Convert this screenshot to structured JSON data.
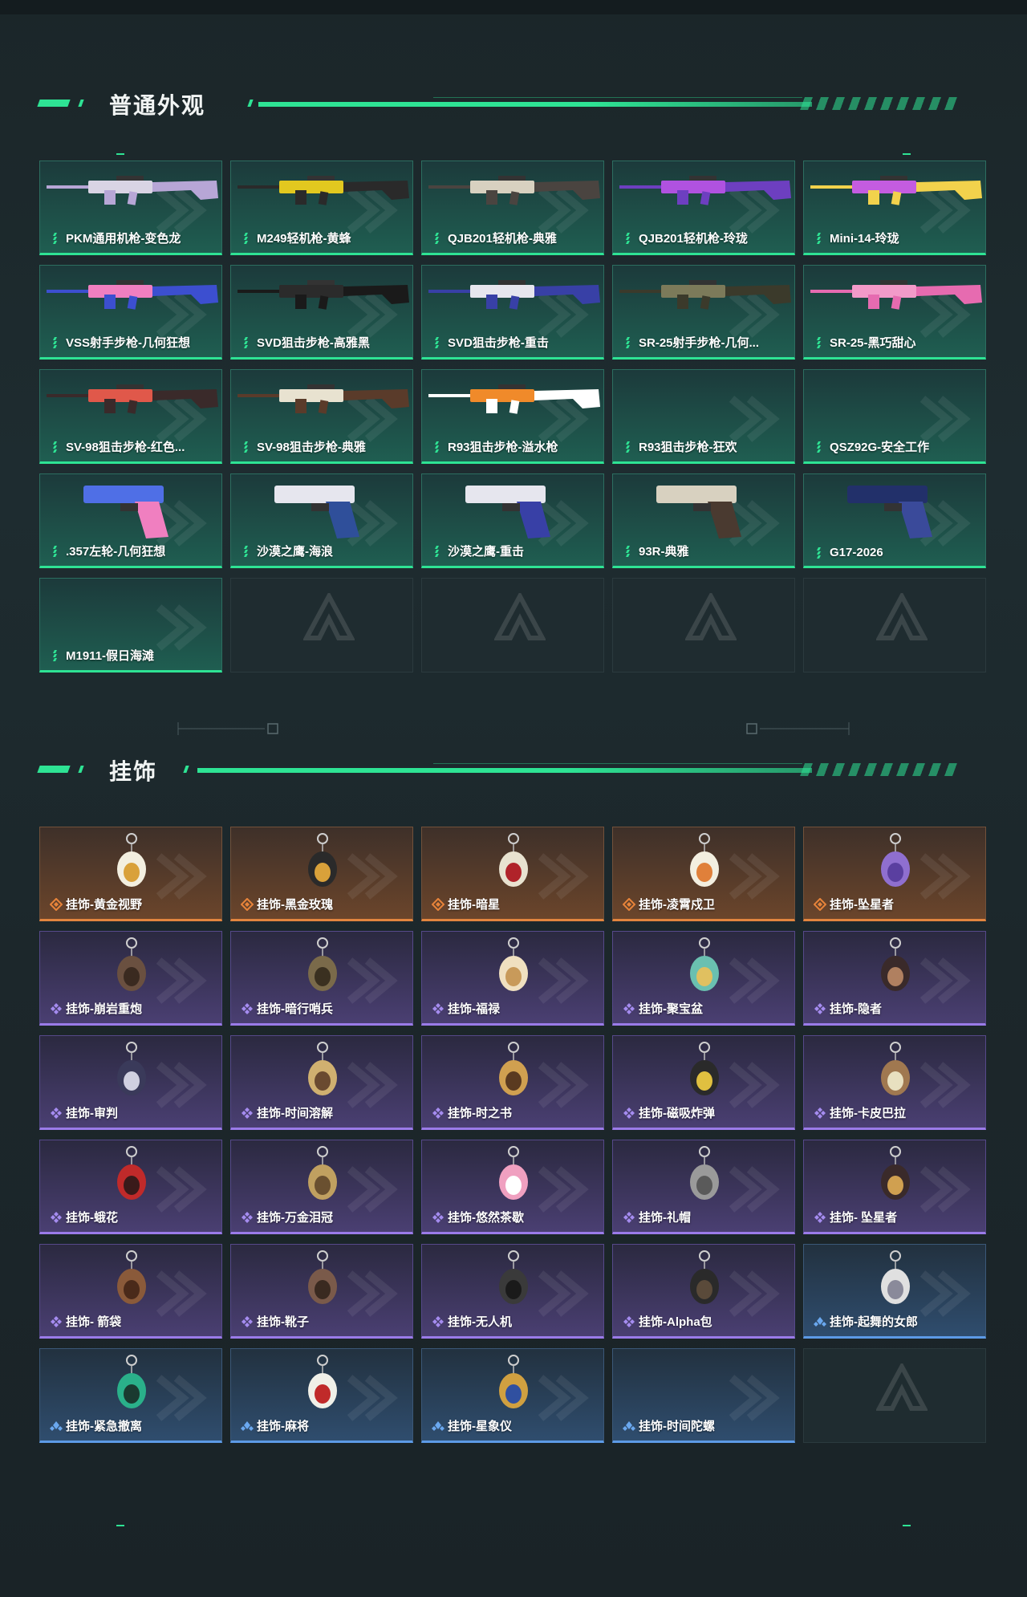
{
  "sections": [
    {
      "title": "普通外观",
      "items": [
        {
          "label": "PKM通用机枪-变色龙",
          "quality": "green",
          "art": "rifle",
          "colors": [
            "#d9d4e4",
            "#b7a6d6"
          ]
        },
        {
          "label": "M249轻机枪-黄蜂",
          "quality": "green",
          "art": "rifle",
          "colors": [
            "#e2c81f",
            "#2a2a2a"
          ]
        },
        {
          "label": "QJB201轻机枪-典雅",
          "quality": "green",
          "art": "rifle",
          "colors": [
            "#d8d1c0",
            "#4a4440"
          ]
        },
        {
          "label": "QJB201轻机枪-玲珑",
          "quality": "green",
          "art": "rifle",
          "colors": [
            "#b052e0",
            "#6d3fc0"
          ]
        },
        {
          "label": "Mini-14-玲珑",
          "quality": "green",
          "art": "rifle",
          "colors": [
            "#c45ce0",
            "#f2d24c"
          ]
        },
        {
          "label": "VSS射手步枪-几何狂想",
          "quality": "green",
          "art": "rifle",
          "colors": [
            "#f07fc0",
            "#3c4fd0"
          ]
        },
        {
          "label": "SVD狙击步枪-高雅黑",
          "quality": "green",
          "art": "rifle",
          "colors": [
            "#2b2b2b",
            "#1a1a1a"
          ]
        },
        {
          "label": "SVD狙击步枪-重击",
          "quality": "green",
          "art": "rifle",
          "colors": [
            "#e6e6ee",
            "#3840a6"
          ]
        },
        {
          "label": "SR-25射手步枪-几何...",
          "quality": "green",
          "art": "rifle",
          "colors": [
            "#7c7a5a",
            "#3b3a2b"
          ]
        },
        {
          "label": "SR-25-黑巧甜心",
          "quality": "green",
          "art": "rifle",
          "colors": [
            "#f29ac9",
            "#e66bb0"
          ]
        },
        {
          "label": "SV-98狙击步枪-红色...",
          "quality": "green",
          "art": "rifle",
          "colors": [
            "#e0584a",
            "#3a2a2a"
          ]
        },
        {
          "label": "SV-98狙击步枪-典雅",
          "quality": "green",
          "art": "rifle",
          "colors": [
            "#e8e2d0",
            "#5a3b2a"
          ]
        },
        {
          "label": "R93狙击步枪-溢水枪",
          "quality": "green",
          "art": "rifle",
          "colors": [
            "#f08a2a",
            "#ffffff"
          ]
        },
        {
          "label": "R93狙击步枪-狂欢",
          "quality": "green",
          "art": "none",
          "colors": []
        },
        {
          "label": "QSZ92G-安全工作",
          "quality": "green",
          "art": "none",
          "colors": []
        },
        {
          "label": ".357左轮-几何狂想",
          "quality": "green",
          "art": "revolver",
          "colors": [
            "#4f6fe6",
            "#f07fc0"
          ]
        },
        {
          "label": "沙漠之鹰-海浪",
          "quality": "green",
          "art": "pistol",
          "colors": [
            "#e6e6ee",
            "#2f4f9a"
          ]
        },
        {
          "label": "沙漠之鹰-重击",
          "quality": "green",
          "art": "pistol",
          "colors": [
            "#e6e6ee",
            "#3840a6"
          ]
        },
        {
          "label": "93R-典雅",
          "quality": "green",
          "art": "pistol",
          "colors": [
            "#d8d1c0",
            "#4a3a30"
          ]
        },
        {
          "label": "G17-2026",
          "quality": "green",
          "art": "pistol",
          "colors": [
            "#22306a",
            "#3a4a9a"
          ]
        },
        {
          "label": "M1911-假日海滩",
          "quality": "green",
          "art": "none",
          "colors": []
        },
        {
          "label": "",
          "quality": "empty",
          "art": "none",
          "colors": []
        },
        {
          "label": "",
          "quality": "empty",
          "art": "none",
          "colors": []
        },
        {
          "label": "",
          "quality": "empty",
          "art": "none",
          "colors": []
        },
        {
          "label": "",
          "quality": "empty",
          "art": "none",
          "colors": []
        }
      ]
    },
    {
      "title": "挂饰",
      "items": [
        {
          "label": "挂饰-黄金视野",
          "quality": "orange",
          "art": "charm",
          "colors": [
            "#f3efe0",
            "#d9a13a"
          ]
        },
        {
          "label": "挂饰-黑金玫瑰",
          "quality": "orange",
          "art": "charm",
          "colors": [
            "#2a2a2a",
            "#d9a13a"
          ]
        },
        {
          "label": "挂饰-暗星",
          "quality": "orange",
          "art": "charm",
          "colors": [
            "#e8e2d0",
            "#b0232a"
          ]
        },
        {
          "label": "挂饰-凌霄戍卫",
          "quality": "orange",
          "art": "charm",
          "colors": [
            "#f3efe0",
            "#e0803a"
          ]
        },
        {
          "label": "挂饰-坠星者",
          "quality": "orange",
          "art": "charm",
          "colors": [
            "#8f6fd0",
            "#5a3fa0"
          ]
        },
        {
          "label": "挂饰-崩岩重炮",
          "quality": "purple",
          "art": "charm",
          "colors": [
            "#6a5040",
            "#3a2a20"
          ]
        },
        {
          "label": "挂饰-暗行哨兵",
          "quality": "purple",
          "art": "charm",
          "colors": [
            "#7a6a4a",
            "#3a3020"
          ]
        },
        {
          "label": "挂饰-福禄",
          "quality": "purple",
          "art": "charm",
          "colors": [
            "#f0e0c0",
            "#c89a5a"
          ]
        },
        {
          "label": "挂饰-聚宝盆",
          "quality": "purple",
          "art": "charm",
          "colors": [
            "#6ac0b0",
            "#e0c060"
          ]
        },
        {
          "label": "挂饰-隐者",
          "quality": "purple",
          "art": "charm",
          "colors": [
            "#3a2a2a",
            "#b08060"
          ]
        },
        {
          "label": "挂饰-审判",
          "quality": "purple",
          "art": "charm",
          "colors": [
            "#3a3a5a",
            "#d0d0e0"
          ]
        },
        {
          "label": "挂饰-时间溶解",
          "quality": "purple",
          "art": "charm",
          "colors": [
            "#d0b070",
            "#6a4a30"
          ]
        },
        {
          "label": "挂饰-时之书",
          "quality": "purple",
          "art": "charm",
          "colors": [
            "#d0a050",
            "#5a3a20"
          ]
        },
        {
          "label": "挂饰-磁吸炸弹",
          "quality": "purple",
          "art": "charm",
          "colors": [
            "#2a2a2a",
            "#e0c040"
          ]
        },
        {
          "label": "挂饰-卡皮巴拉",
          "quality": "purple",
          "art": "charm",
          "colors": [
            "#a07850",
            "#e8e0c0"
          ]
        },
        {
          "label": "挂饰-蛾花",
          "quality": "purple",
          "art": "charm",
          "colors": [
            "#c02a2a",
            "#3a1a1a"
          ]
        },
        {
          "label": "挂饰-万金泪冠",
          "quality": "purple",
          "art": "charm",
          "colors": [
            "#c0a060",
            "#6a5030"
          ]
        },
        {
          "label": "挂饰-悠然茶歇",
          "quality": "purple",
          "art": "charm",
          "colors": [
            "#f0a0c0",
            "#ffffff"
          ]
        },
        {
          "label": "挂饰-礼帽",
          "quality": "purple",
          "art": "charm",
          "colors": [
            "#9a9a9a",
            "#5a5a5a"
          ]
        },
        {
          "label": "挂饰- 坠星者",
          "quality": "purple",
          "art": "charm",
          "colors": [
            "#3a2a2a",
            "#d0a050"
          ]
        },
        {
          "label": "挂饰- 箭袋",
          "quality": "purple",
          "art": "charm",
          "colors": [
            "#8a5a3a",
            "#4a2a1a"
          ]
        },
        {
          "label": "挂饰-靴子",
          "quality": "purple",
          "art": "charm",
          "colors": [
            "#7a5a4a",
            "#3a2a20"
          ]
        },
        {
          "label": "挂饰-无人机",
          "quality": "purple",
          "art": "charm",
          "colors": [
            "#3a3a3a",
            "#1a1a1a"
          ]
        },
        {
          "label": "挂饰-Alpha包",
          "quality": "purple",
          "art": "charm",
          "colors": [
            "#2a2a2a",
            "#5a4a3a"
          ]
        },
        {
          "label": "挂饰-起舞的女郎",
          "quality": "blue",
          "art": "charm",
          "colors": [
            "#e0e0e0",
            "#8a8a9a"
          ]
        },
        {
          "label": "挂饰-紧急撤离",
          "quality": "blue",
          "art": "charm",
          "colors": [
            "#2ab08a",
            "#1a3a30"
          ]
        },
        {
          "label": "挂饰-麻将",
          "quality": "blue",
          "art": "charm",
          "colors": [
            "#f0f0e8",
            "#c02a2a"
          ]
        },
        {
          "label": "挂饰-星象仪",
          "quality": "blue",
          "art": "charm",
          "colors": [
            "#d0a040",
            "#3050a0"
          ]
        },
        {
          "label": "挂饰-时间陀螺",
          "quality": "blue",
          "art": "none",
          "colors": []
        },
        {
          "label": "",
          "quality": "empty",
          "art": "none",
          "colors": []
        }
      ]
    }
  ]
}
